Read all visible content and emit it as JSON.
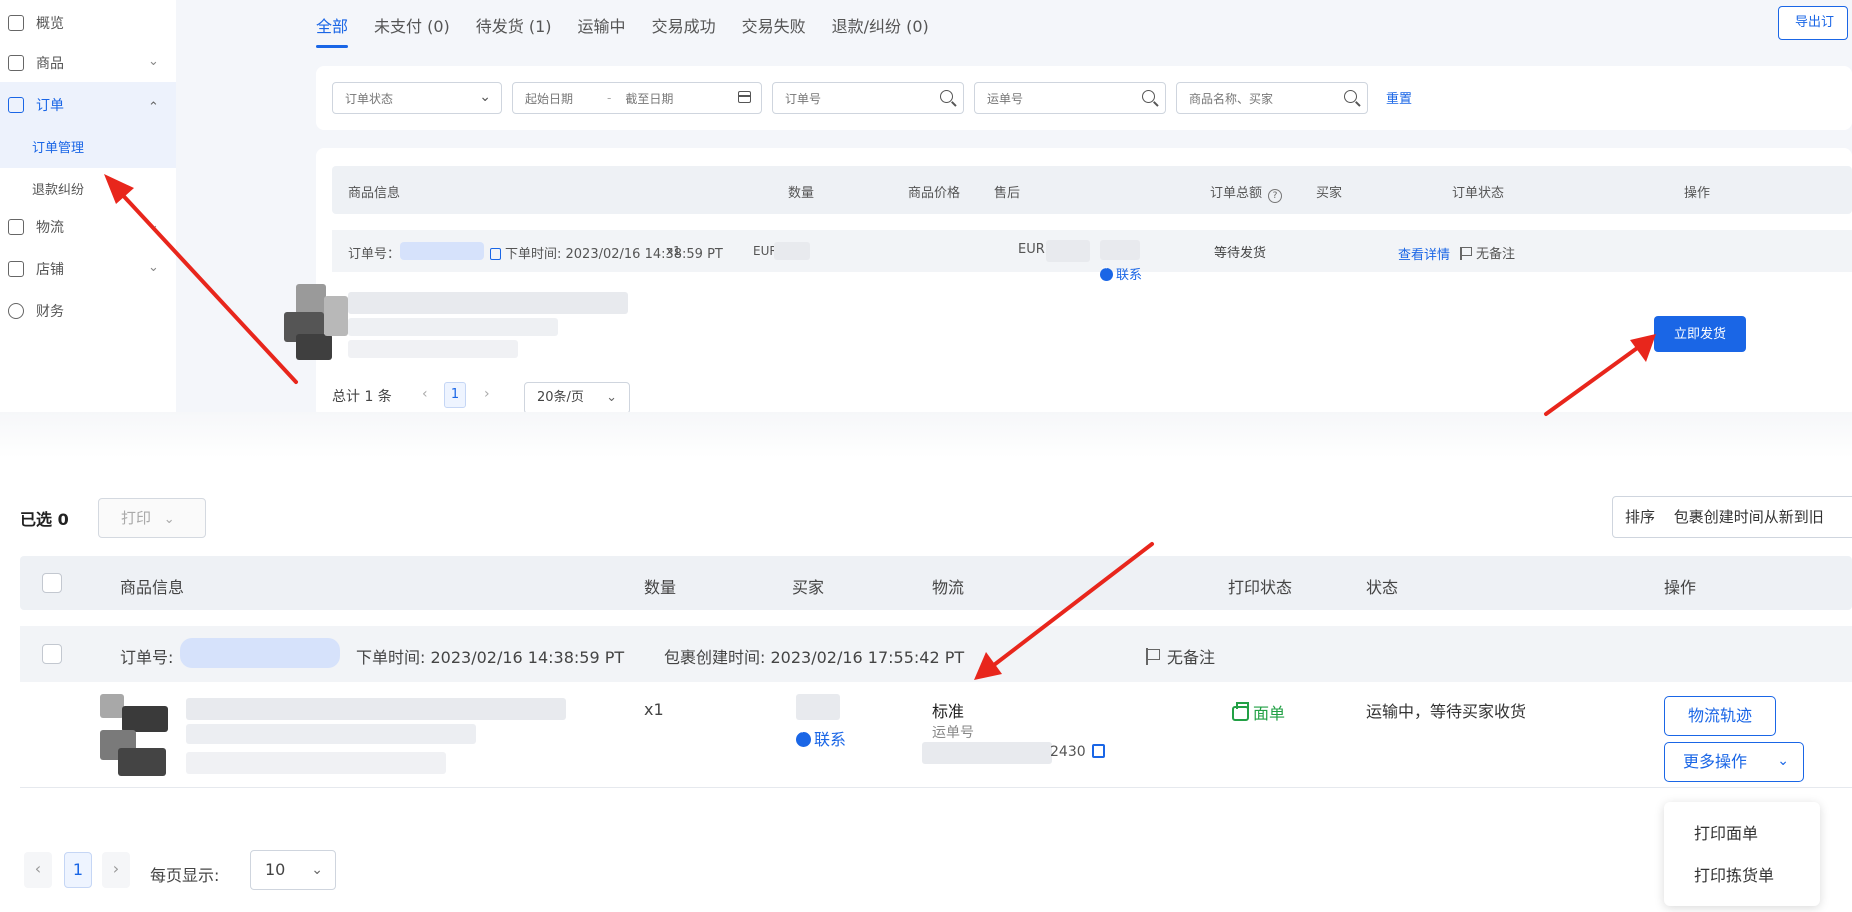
{
  "sidebar": {
    "items": [
      {
        "label": "概览",
        "icon": "home-icon"
      },
      {
        "label": "商品",
        "icon": "goods-icon"
      },
      {
        "label": "订单",
        "icon": "order-icon"
      },
      {
        "label": "物流",
        "icon": "logistics-icon"
      },
      {
        "label": "店铺",
        "icon": "store-icon"
      },
      {
        "label": "财务",
        "icon": "finance-icon"
      }
    ],
    "sub_items": {
      "order_manage": "订单管理",
      "refund_dispute": "退款纠纷"
    },
    "chevron_down": "⌄",
    "chevron_up": "⌃"
  },
  "tabs": [
    {
      "label": "全部"
    },
    {
      "label": "未支付 (0)"
    },
    {
      "label": "待发货 (1)"
    },
    {
      "label": "运输中"
    },
    {
      "label": "交易成功"
    },
    {
      "label": "交易失败"
    },
    {
      "label": "退款/纠纷 (0)"
    }
  ],
  "export_label": "导出订",
  "filters": {
    "order_status": "订单状态",
    "start_date": "起始日期",
    "date_sep": "-",
    "end_date": "截至日期",
    "order_no": "订单号",
    "tracking_no": "运单号",
    "product_buyer": "商品名称、买家",
    "reset": "重置"
  },
  "order_table": {
    "headers": {
      "product_info": "商品信息",
      "quantity": "数量",
      "price": "商品价格",
      "after_sale": "售后",
      "total": "订单总额",
      "buyer": "买家",
      "status": "订单状态",
      "action": "操作"
    },
    "help_glyph": "?",
    "order": {
      "order_no_label": "订单号：1",
      "order_time": "下单时间: 2023/02/16 14:38:59 PT",
      "no_remark": "无备注",
      "quantity": "x1",
      "price": "EUR",
      "total": "EUR",
      "contact": "联系",
      "status": "等待发货",
      "view_detail": "查看详情",
      "ship_now": "立即发货"
    }
  },
  "pagination_top": {
    "total": "总计 1 条",
    "prev": "‹",
    "page": "1",
    "next": "›",
    "page_size": "20条/页"
  },
  "package_panel": {
    "selected_label": "已选",
    "selected_count": "0",
    "print_label": "打印",
    "sort_label": "排序",
    "sort_value": "包裹创建时间从新到旧",
    "headers": {
      "product_info": "商品信息",
      "quantity": "数量",
      "buyer": "买家",
      "logistics": "物流",
      "print_status": "打印状态",
      "status": "状态",
      "action": "操作"
    },
    "order": {
      "order_no_label": "订单号:",
      "order_time": "下单时间: 2023/02/16 14:38:59 PT",
      "package_time": "包裹创建时间: 2023/02/16 17:55:42 PT",
      "no_remark": "无备注",
      "quantity": "x1",
      "contact": "联系",
      "logistics_type": "标准",
      "tracking_label": "运单号",
      "tracking_tail": "2430",
      "print_status": "面单",
      "status": "运输中，等待买家收货",
      "track_button": "物流轨迹",
      "more_button": "更多操作"
    },
    "dropdown": [
      "打印面单",
      "打印拣货单"
    ],
    "pagination": {
      "prev": "‹",
      "page": "1",
      "next": "›",
      "per_page_label": "每页显示:",
      "per_page": "10"
    }
  },
  "colors": {
    "primary": "#1a66e6",
    "success": "#22a045",
    "arrow": "#e8261c"
  }
}
